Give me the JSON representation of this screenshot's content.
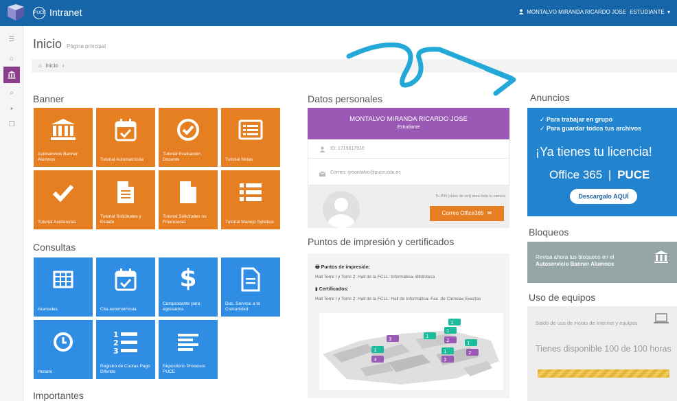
{
  "topbar": {
    "brand_badge": "PUCE",
    "brand": "Intranet",
    "user": "MONTALVO MIRANDA RICARDO JOSE",
    "role": "ESTUDIANTE",
    "caret": "▾",
    "accent": "#1565a8"
  },
  "sidebar": {
    "items": [
      {
        "icon": "menu-icon",
        "glyph": "☰"
      },
      {
        "icon": "home-icon",
        "glyph": "⌂"
      },
      {
        "icon": "institution-icon",
        "glyph": "🏛"
      },
      {
        "icon": "search-icon",
        "glyph": "⌕"
      },
      {
        "icon": "circle-icon",
        "glyph": "●"
      },
      {
        "icon": "copy-icon",
        "glyph": "❐"
      }
    ]
  },
  "page": {
    "title": "Inicio",
    "subtitle": "Página principal",
    "breadcrumb": "Inicio",
    "breadcrumb_sep": "›"
  },
  "banner": {
    "title": "Banner",
    "tiles": [
      {
        "label": "Autoservicio Banner Alumnos",
        "icon": "institution-icon"
      },
      {
        "label": "Tutorial Automatrícula",
        "icon": "calendar-check-icon"
      },
      {
        "label": "Tutorial Evaluación Docente",
        "icon": "check-circle-icon"
      },
      {
        "label": "Tutorial Notas",
        "icon": "list-alt-icon"
      },
      {
        "label": "Tutorial Asistencias",
        "icon": "check-icon"
      },
      {
        "label": "Tutorial Solicitudes y Estado",
        "icon": "file-text-icon"
      },
      {
        "label": "Tutorial Solicitudes no Financieras",
        "icon": "file-icon"
      },
      {
        "label": "Tutorial Manejo Syllabus",
        "icon": "list-icon"
      }
    ]
  },
  "consultas": {
    "title": "Consultas",
    "tiles": [
      {
        "label": "Aranceles",
        "icon": "table-icon"
      },
      {
        "label": "Cita automatrícula",
        "icon": "calendar-check-icon"
      },
      {
        "label": "Comprobante para egresados",
        "icon": "dollar-icon"
      },
      {
        "label": "Doc. Servicio a la Comunidad",
        "icon": "document-icon"
      },
      {
        "label": "Horario",
        "icon": "clock-icon"
      },
      {
        "label": "Registro de Cuotas Pago Diferido",
        "icon": "ordered-list-icon"
      },
      {
        "label": "Repositorio Procesos PUCE",
        "icon": "align-left-icon"
      }
    ]
  },
  "importantes": {
    "title": "Importantes"
  },
  "datos": {
    "title": "Datos personales",
    "name": "MONTALVO MIRANDA RICARDO JOSE",
    "role": "Estudiante",
    "id": "ID: 1719817916",
    "email": "Correo: rjmontalvo@puce.edu.ec",
    "pin_note": "Tu PIN (clave de red) dura toda tu carrera",
    "button": "Correo Office365",
    "accent": "#9b59b6"
  },
  "puntos": {
    "title": "Puntos de impresión y certificados",
    "print_heading": "Puntos de impresión:",
    "print_text": "Hall Torre I y Torre 2: Hall de la FCLL: Informática: Biblioteca",
    "cert_heading": "Certificados:",
    "cert_text": "Hall Torre I y Torre 2: Hall de la FCLL: Hall de Informática: Fac. de Ciencias Exactas",
    "markers": [
      "1",
      "1",
      "3",
      "1",
      "1",
      "2",
      "1",
      "3",
      "2",
      "1",
      "3"
    ]
  },
  "anuncios": {
    "title": "Anuncios",
    "check1": "✓ Para trabajar en grupo",
    "check2": "✓ Para guardar todos tus archivos",
    "headline": "¡Ya tienes tu licencia!",
    "product": "Office 365",
    "brand": "PUCE",
    "button": "Descargalo AQUÍ",
    "accent": "#2283cf"
  },
  "bloqueos": {
    "title": "Bloqueos",
    "text1": "Revisa ahora tus bloqueos en el",
    "text2": "Autoservicio Banner Alumnos"
  },
  "uso": {
    "title": "Uso de equipos",
    "text1": "Saldo de uso de Horas de Internet y equipos",
    "text2": "Tienes disponible 100 de 100 horas",
    "available": 100,
    "total": 100
  }
}
